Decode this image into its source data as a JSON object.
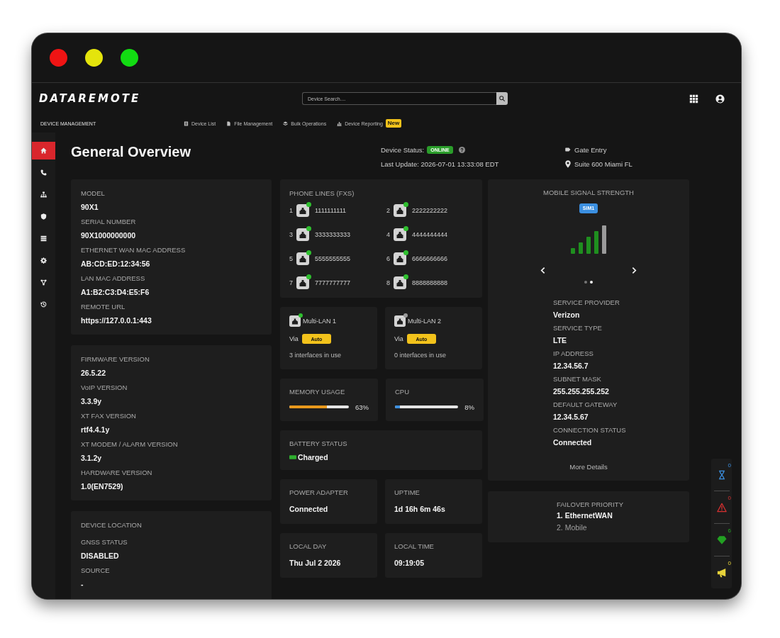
{
  "window": {
    "buttons": [
      {
        "color": "#f01414"
      },
      {
        "color": "#e4e40c"
      },
      {
        "color": "#12dc12"
      }
    ]
  },
  "header": {
    "logo": "DATAREMOTE",
    "search": {
      "placeholder": "Device Search...."
    }
  },
  "nav": {
    "section": "DEVICE MANAGEMENT",
    "tabs": [
      {
        "label": "Device List"
      },
      {
        "label": "File Management"
      },
      {
        "label": "Bulk Operations"
      },
      {
        "label": "Device Reporting",
        "badge": "New"
      }
    ]
  },
  "sidebar": {
    "items": [
      {
        "selected": true
      },
      {
        "selected": false
      },
      {
        "selected": false
      },
      {
        "selected": false
      },
      {
        "selected": false
      },
      {
        "selected": false
      },
      {
        "selected": false
      },
      {
        "selected": false
      }
    ]
  },
  "page": {
    "title": "General Overview",
    "status": {
      "label": "Device Status:",
      "value": "ONLINE",
      "last_update": "Last Update: 2026-07-01 13:33:08 EDT"
    },
    "location": {
      "name": "Gate Entry",
      "address": "Suite 600 Miami FL"
    }
  },
  "info_cards": [
    {
      "fields": [
        {
          "label": "MODEL",
          "value": "90X1"
        },
        {
          "label": "SERIAL NUMBER",
          "value": "90X1000000000"
        },
        {
          "label": "ETHERNET WAN MAC ADDRESS",
          "value": "AB:CD:ED:12:34:56"
        },
        {
          "label": "LAN MAC ADDRESS",
          "value": "A1:B2:C3:D4:E5:F6"
        },
        {
          "label": "REMOTE URL",
          "value": "https://127.0.0.1:443"
        }
      ]
    },
    {
      "fields": [
        {
          "label": "FIRMWARE VERSION",
          "value": "26.5.22"
        },
        {
          "label": "VoIP VERSION",
          "value": "3.3.9y"
        },
        {
          "label": "XT FAX VERSION",
          "value": "rtf4.4.1y"
        },
        {
          "label": "XT MODEM / ALARM VERSION",
          "value": "3.1.2y"
        },
        {
          "label": "HARDWARE VERSION",
          "value": "1.0(EN7529)"
        }
      ]
    },
    {
      "title": "DEVICE LOCATION",
      "fields": [
        {
          "label": "GNSS STATUS",
          "value": "DISABLED"
        },
        {
          "label": "SOURCE",
          "value": "-"
        }
      ]
    }
  ],
  "phone_lines": {
    "title": "PHONE LINES (FXS)",
    "lines": [
      {
        "port": "1",
        "number": "1111111111",
        "active": true
      },
      {
        "port": "2",
        "number": "2222222222",
        "active": true
      },
      {
        "port": "3",
        "number": "3333333333",
        "active": true
      },
      {
        "port": "4",
        "number": "4444444444",
        "active": true
      },
      {
        "port": "5",
        "number": "5555555555",
        "active": true
      },
      {
        "port": "6",
        "number": "6666666666",
        "active": true
      },
      {
        "port": "7",
        "number": "7777777777",
        "active": true
      },
      {
        "port": "8",
        "number": "8888888888",
        "active": true
      }
    ]
  },
  "multi_lan": [
    {
      "name": "Multi-LAN 1",
      "active": true,
      "via": "Via",
      "mode": "Auto",
      "usage": "3 interfaces in use"
    },
    {
      "name": "Multi-LAN 2",
      "active": false,
      "via": "Via",
      "mode": "Auto",
      "usage": "0 interfaces in use"
    }
  ],
  "meters": [
    {
      "label": "MEMORY USAGE",
      "level": 0.63,
      "reading": "63%",
      "color": "#e8981c"
    },
    {
      "label": "CPU",
      "level": 0.08,
      "reading": "8%",
      "color": "#3b8fe0"
    }
  ],
  "battery": {
    "label": "BATTERY STATUS",
    "value": "Charged"
  },
  "stats": [
    {
      "label": "POWER ADAPTER",
      "value": "Connected"
    },
    {
      "label": "UPTIME",
      "value": "1d 16h 6m 46s"
    },
    {
      "label": "LOCAL DAY",
      "value": "Thu Jul 2 2026"
    },
    {
      "label": "LOCAL TIME",
      "value": "09:19:05"
    }
  ],
  "mobile": {
    "title": "MOBILE SIGNAL STRENGTH",
    "sim": "SIM1",
    "slides": [
      {
        "selected": false
      },
      {
        "selected": true
      }
    ],
    "fields": [
      {
        "label": "SERVICE PROVIDER",
        "value": "Verizon"
      },
      {
        "label": "SERVICE TYPE",
        "value": "LTE"
      },
      {
        "label": "IP ADDRESS",
        "value": "12.34.56.7"
      },
      {
        "label": "SUBNET MASK",
        "value": "255.255.255.252"
      },
      {
        "label": "DEFAULT GATEWAY",
        "value": "12.34.5.67"
      },
      {
        "label": "CONNECTION STATUS",
        "value": "Connected"
      }
    ],
    "link": "More Details"
  },
  "failover": {
    "title": "FAILOVER PRIORITY",
    "items": [
      {
        "label": "1. EthernetWAN",
        "active": true
      },
      {
        "label": "2. Mobile",
        "active": false
      }
    ]
  },
  "dock": [
    {
      "count": "0",
      "color": "#3b8fe0"
    },
    {
      "count": "0",
      "color": "#d63030"
    },
    {
      "count": "6",
      "color": "#22a022"
    },
    {
      "count": "0",
      "color": "#e6d23a"
    }
  ]
}
